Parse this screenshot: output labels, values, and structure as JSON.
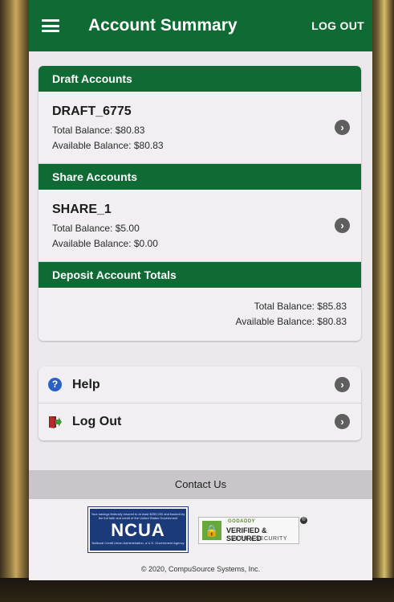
{
  "header": {
    "title": "Account Summary",
    "logout_label": "LOG OUT",
    "menu_icon": "hamburger-menu-icon"
  },
  "draft_accounts": {
    "heading": "Draft Accounts",
    "items": [
      {
        "name": "DRAFT_6775",
        "total_balance": "Total Balance: $80.83",
        "available_balance": "Available Balance: $80.83"
      }
    ]
  },
  "share_accounts": {
    "heading": "Share Accounts",
    "items": [
      {
        "name": "SHARE_1",
        "total_balance": "Total Balance: $5.00",
        "available_balance": "Available Balance: $0.00"
      }
    ]
  },
  "deposit_totals": {
    "heading": "Deposit Account Totals",
    "total_balance": "Total Balance: $85.83",
    "available_balance": "Available Balance: $80.83"
  },
  "menu": {
    "items": [
      {
        "label": "Help",
        "icon": "help-icon"
      },
      {
        "label": "Log Out",
        "icon": "logout-icon"
      }
    ]
  },
  "footer": {
    "contact_label": "Contact Us",
    "ncua_label": "NCUA",
    "ncua_fine_top": "Your savings federally insured to at least $250,000 and backed by the full faith and credit of the United States Government",
    "ncua_fine_bottom": "National Credit Union Administration, a U.S. Government Agency",
    "seal_brand": "GODADDY",
    "seal_title": "VERIFIED & SECURED",
    "seal_subtitle": "VERIFY SECURITY",
    "registered_mark": "®",
    "copyright": "© 2020, CompuSource Systems, Inc."
  },
  "colors": {
    "primary_green": "#0f6b33",
    "background": "#ece9ec",
    "ncua_blue": "#1a3a7a",
    "help_blue": "#2b5fc6"
  }
}
